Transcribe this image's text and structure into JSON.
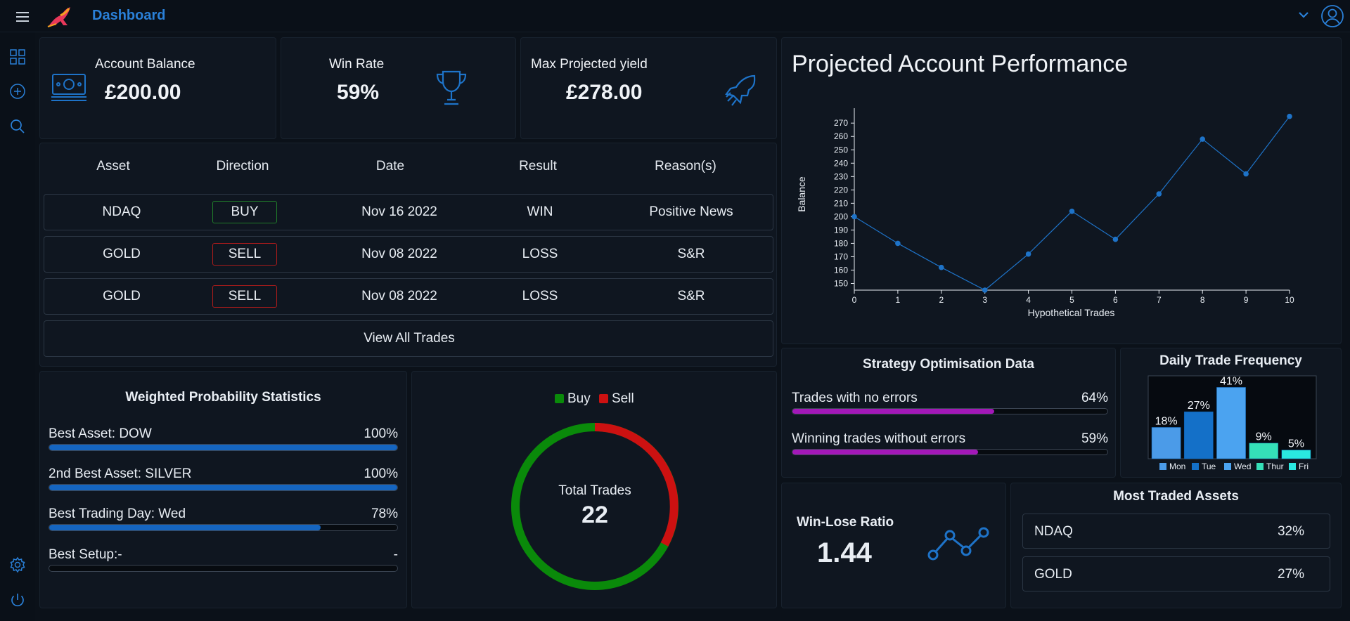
{
  "header": {
    "title": "Dashboard",
    "menu_icon": "hamburger-menu-icon",
    "logo_icon": "kangaroo-logo-icon",
    "dropdown_icon": "chevron-down-icon",
    "avatar_icon": "user-circle-icon"
  },
  "sidebar": {
    "items": [
      {
        "icon": "grid-icon"
      },
      {
        "icon": "add-circle-icon"
      },
      {
        "icon": "search-icon"
      }
    ],
    "bottom": [
      {
        "icon": "gear-icon"
      },
      {
        "icon": "power-icon"
      }
    ]
  },
  "kpis": {
    "balance": {
      "label": "Account Balance",
      "value": "£200.00",
      "icon": "cash-icon"
    },
    "win_rate": {
      "label": "Win Rate",
      "value": "59%",
      "icon": "trophy-icon"
    },
    "max_yield": {
      "label": "Max Projected yield",
      "value": "£278.00",
      "icon": "rocket-icon"
    }
  },
  "trades": {
    "headers": [
      "Asset",
      "Direction",
      "Date",
      "Result",
      "Reason(s)"
    ],
    "rows": [
      {
        "asset": "NDAQ",
        "direction": "BUY",
        "date": "Nov 16 2022",
        "result": "WIN",
        "reason": "Positive News"
      },
      {
        "asset": "GOLD",
        "direction": "SELL",
        "date": "Nov 08 2022",
        "result": "LOSS",
        "reason": "S&R"
      },
      {
        "asset": "GOLD",
        "direction": "SELL",
        "date": "Nov 08 2022",
        "result": "LOSS",
        "reason": "S&R"
      }
    ],
    "view_all_label": "View All Trades"
  },
  "weighted_stats": {
    "title": "Weighted Probability Statistics",
    "items": [
      {
        "label": "Best Asset: DOW",
        "value_text": "100%",
        "fill": 1.0
      },
      {
        "label": "2nd Best Asset: SILVER",
        "value_text": "100%",
        "fill": 1.0
      },
      {
        "label": "Best Trading Day: Wed",
        "value_text": "78%",
        "fill": 0.78
      },
      {
        "label": "Best Setup:-",
        "value_text": "-",
        "fill": 0
      }
    ]
  },
  "donut": {
    "legend": [
      {
        "name": "Buy",
        "color": "#0a8a0a"
      },
      {
        "name": "Sell",
        "color": "#cc1111"
      }
    ],
    "center_label": "Total Trades",
    "center_value": "22"
  },
  "chart_data": [
    {
      "type": "line",
      "title": "Projected Account Performance",
      "xlabel": "Hypothetical Trades",
      "ylabel": "Balance",
      "x": [
        0,
        1,
        2,
        3,
        4,
        5,
        6,
        7,
        8,
        9,
        10
      ],
      "y": [
        200,
        180,
        162,
        145,
        172,
        204,
        183,
        217,
        258,
        232,
        275
      ],
      "xlim": [
        0,
        10
      ],
      "ylim": [
        145,
        278
      ],
      "yticks": [
        150,
        160,
        170,
        180,
        190,
        200,
        210,
        220,
        230,
        240,
        250,
        260,
        270
      ],
      "color": "#1e73c8"
    },
    {
      "type": "bar",
      "title": "Daily Trade Frequency",
      "categories": [
        "Mon",
        "Tue",
        "Wed",
        "Thur",
        "Fri"
      ],
      "values": [
        18,
        27,
        41,
        9,
        5
      ],
      "labels": [
        "18%",
        "27%",
        "41%",
        "9%",
        "5%"
      ],
      "colors": [
        "#4b9be8",
        "#1470c8",
        "#4ba3f0",
        "#35e0b8",
        "#2ae8e0"
      ]
    }
  ],
  "strategy": {
    "title": "Strategy Optimisation Data",
    "items": [
      {
        "label": "Trades with no errors",
        "value_text": "64%",
        "fill": 0.64
      },
      {
        "label": "Winning trades without errors",
        "value_text": "59%",
        "fill": 0.59
      }
    ]
  },
  "win_lose": {
    "label": "Win-Lose Ratio",
    "value": "1.44",
    "icon": "trend-line-icon"
  },
  "most_traded": {
    "title": "Most Traded Assets",
    "rows": [
      {
        "asset": "NDAQ",
        "pct": "32%"
      },
      {
        "asset": "GOLD",
        "pct": "27%"
      }
    ]
  }
}
